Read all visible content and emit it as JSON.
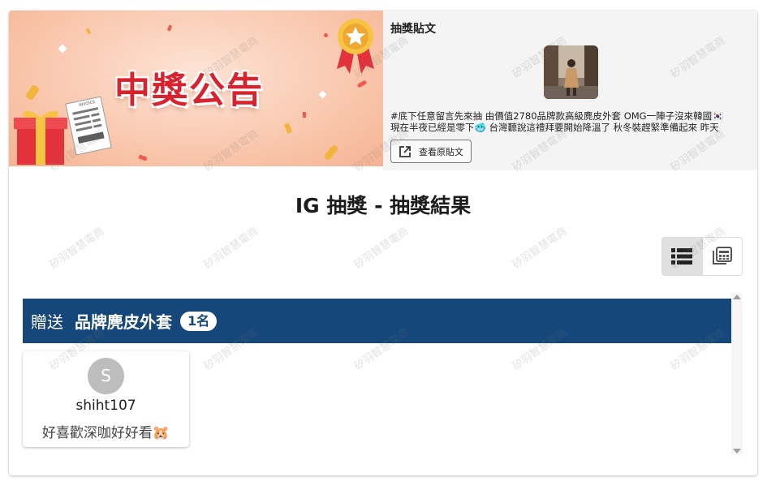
{
  "banner": {
    "title": "中獎公告",
    "receipt_label": "INVOICE"
  },
  "post": {
    "heading": "抽獎貼文",
    "line1": "#底下任意留言先來抽 由價值2780品牌款高級麂皮外套 OMG一陣子沒來韓國🇰🇷",
    "line2": "現在半夜已經是零下🥶 台灣聽說這禮拜要開始降溫了 秋冬裝趕緊準備起來 昨天",
    "view_button": "查看原貼文"
  },
  "page": {
    "title": "IG 抽獎 - 抽獎結果"
  },
  "view_toggle": {
    "active": "list"
  },
  "prize": {
    "prefix": "贈送",
    "name": "品牌麂皮外套",
    "count": "1名"
  },
  "winners": [
    {
      "initial": "S",
      "username": "shiht107",
      "comment": "好喜歡深咖好好看🐹"
    }
  ],
  "watermark": "矽羽智慧電商",
  "colors": {
    "prize_bar": "#16477a",
    "title_red": "#d8222d",
    "avatar_gray": "#bdbdbd"
  }
}
